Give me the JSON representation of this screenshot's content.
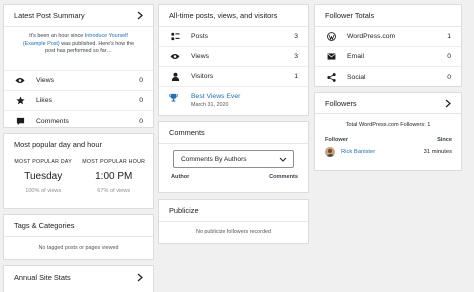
{
  "latest_post": {
    "title": "Latest Post Summary",
    "summary_prefix": "It's been an hour since",
    "post_link": "Introduce Yourself (Example Post)",
    "summary_suffix": "was published. Here's how the post has performed so far…",
    "stats": [
      {
        "icon": "eye-icon",
        "label": "Views",
        "value": "0"
      },
      {
        "icon": "star-icon",
        "label": "Likes",
        "value": "0"
      },
      {
        "icon": "comment-icon",
        "label": "Comments",
        "value": "0"
      }
    ]
  },
  "popular_day_hour": {
    "title": "Most popular day and hour",
    "day_heading": "MOST POPULAR DAY",
    "day_value": "Tuesday",
    "day_pct": "100% of views",
    "hour_heading": "MOST POPULAR HOUR",
    "hour_value": "1:00 PM",
    "hour_pct": "67% of views"
  },
  "tags": {
    "title": "Tags & Categories",
    "empty": "No tagged posts or pages viewed"
  },
  "annual": {
    "title": "Annual Site Stats"
  },
  "alltime": {
    "title": "All-time posts, views, and visitors",
    "rows": [
      {
        "icon": "posts-icon",
        "label": "Posts",
        "value": "3"
      },
      {
        "icon": "eye-icon",
        "label": "Views",
        "value": "3"
      },
      {
        "icon": "person-icon",
        "label": "Visitors",
        "value": "1"
      }
    ],
    "best_label": "Best Views Ever",
    "best_date": "March 31, 2020"
  },
  "comments": {
    "title": "Comments",
    "select_value": "Comments By Authors",
    "col_author": "Author",
    "col_comments": "Comments"
  },
  "publicize": {
    "title": "Publicize",
    "empty": "No publicize followers recorded"
  },
  "follower_totals": {
    "title": "Follower Totals",
    "rows": [
      {
        "icon": "wordpress-icon",
        "label": "WordPress.com",
        "value": "1"
      },
      {
        "icon": "email-icon",
        "label": "Email",
        "value": "0"
      },
      {
        "icon": "social-icon",
        "label": "Social",
        "value": "0"
      }
    ]
  },
  "followers": {
    "title": "Followers",
    "total": "Total WordPress.com Followers: 1",
    "col_follower": "Follower",
    "col_since": "Since",
    "name": "Rick Banister",
    "since": "31 minutes"
  }
}
